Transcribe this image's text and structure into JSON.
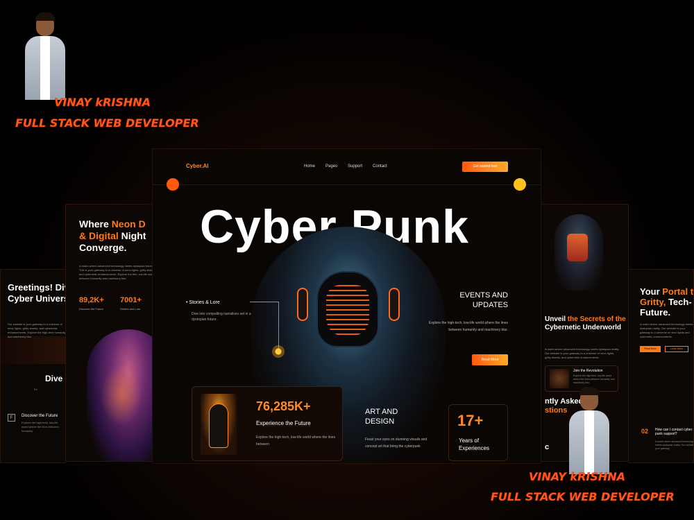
{
  "overlay": {
    "name": "VINAY kRISHNA",
    "name_bottom": "VINAY kRISHNA",
    "role": "FULL STACK WEB DEVELOPER",
    "role_bottom": "FULL STACK WEB DEVELOPER",
    "accent": "#ff5a1a"
  },
  "main": {
    "logo": "Cyber.AI",
    "nav": [
      "Home",
      "Pages",
      "Support",
      "Contact"
    ],
    "cta": "Get started free",
    "hero_title": "Cyber Punk",
    "stories": {
      "title": "Stories & Lore",
      "text": "Dive into compelling narratives set in a dystopian future."
    },
    "events": {
      "title_line1": "EVENTS AND",
      "title_line2": "UPDATES",
      "text": "Explore the high-tech, low-life world where the lines between humanity and machinery blur.",
      "button": "Read More"
    },
    "stat": {
      "number": "76,285K+",
      "label": "Experience the Future",
      "text": "Explore the high-tech, low-life world where the lines between"
    },
    "art": {
      "title_line1": "ART AND",
      "title_line2": "DESIGN",
      "text": "Feast your eyes on stunning visuals and concept art that bring the cyberpunk"
    },
    "experience": {
      "number": "17+",
      "label": "Years of Experiences"
    },
    "accent": "#ff8a2a"
  },
  "left_panel": {
    "title_line1_a": "Where ",
    "title_line1_b": "Neon D",
    "title_line2_a": "& Digital",
    "title_line2_b": " Night",
    "title_line3": "Converge.",
    "text": "A realm where advanced technology meets dystopian futures. This is your gateway to a universe of neon lights, gritty streets, and cybernetic enhancements. Explore the thin, low-life world between humanity and machinery blur.",
    "stat1": "89,2K+",
    "stat1_label": "Discover the Future",
    "stat2": "7001+",
    "stat2_label": "Stories and Lore"
  },
  "far_left_panel": {
    "title": "Greetings! Dive into the Cyber Universe",
    "text": "Our website is your gateway to a universe of neon lights, gritty streets, and cybernetic enhancements. Explore the high-tech humanity and machinery blur.",
    "dive": "Dive i",
    "dive_sub": "Ex",
    "item_icon": "F",
    "item_title": "Discover the Future",
    "item_text": "Explore the high-tech, low-life world where the lines between humanity"
  },
  "right_panel": {
    "title_a": "Unveil ",
    "title_b": "the Secrets of the",
    "title_c": " Cybernetic Underworld",
    "text": "A realm where advanced technology meets dystopian reality. Our website is your gateway to a universe of neon lights, gritty streets, and cybernetic enhancements.",
    "card_title": "Join the Revolution",
    "card_text": "Explore the high-tech, low-life world where the lines between humanity and machinery blur",
    "faq_a": "ntly Asked",
    "faq_b": "stions",
    "c_letter": "c"
  },
  "far_right_panel": {
    "title_a": "Your ",
    "title_b": "Portal to",
    "title_c": "Gritty,",
    "title_d": " Tech-",
    "title_e": "Future.",
    "text": "A realm where advanced technology meets dystopian reality. Our website is your gateway to a universe of neon lights and cybernetic enhancements.",
    "btn1": "Read More",
    "btn2": "Learn More",
    "faq_q_num": "02",
    "faq_q": "How can I contact cyber punk support?",
    "faq_a": "A realm where advanced technology meets dystopian reality. Our website is your gateway"
  }
}
